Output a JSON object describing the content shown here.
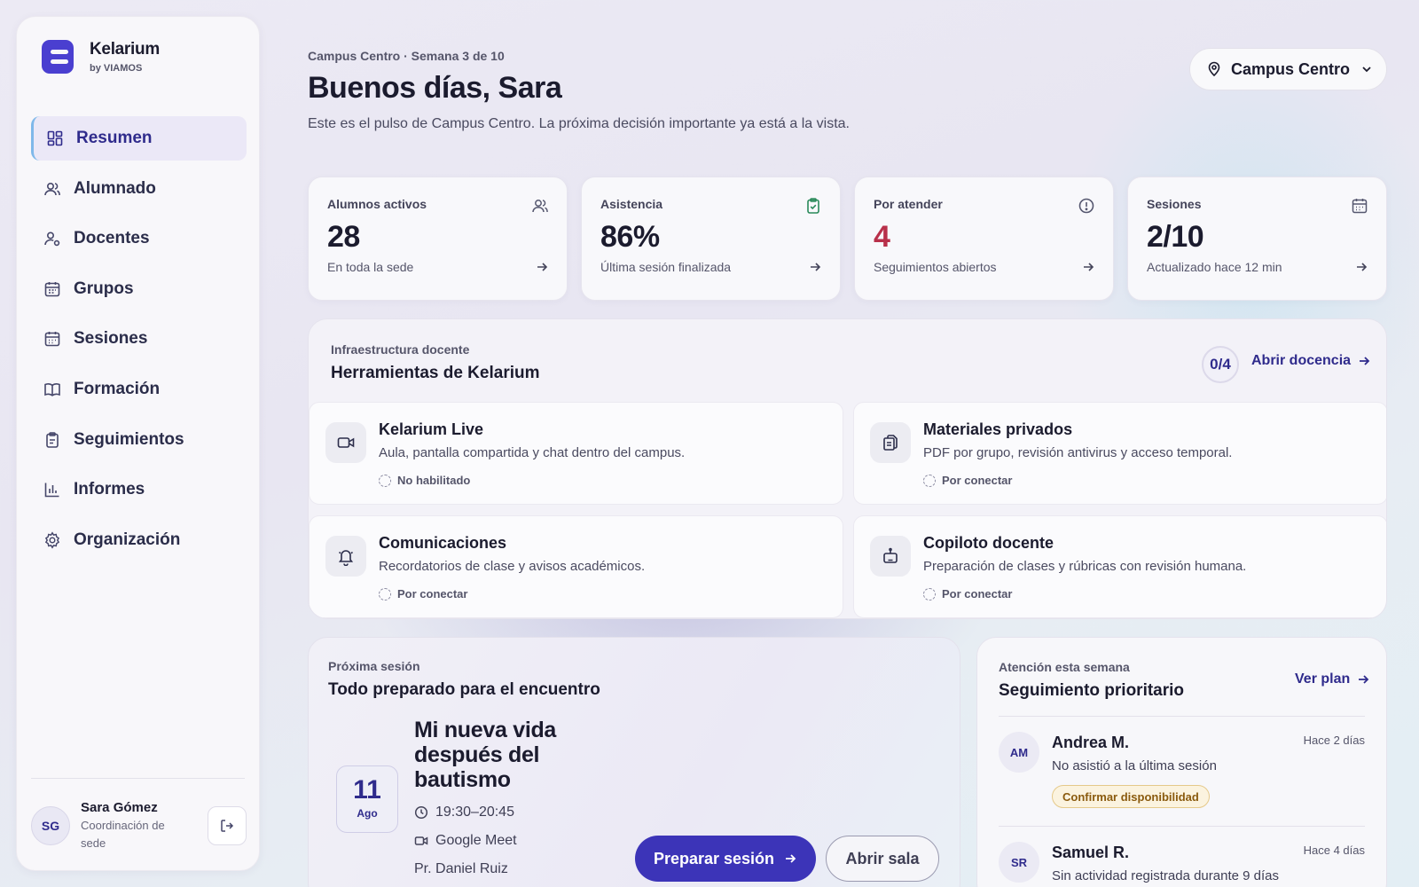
{
  "brand": {
    "name": "Kelarium",
    "sub": "by VIAMOS"
  },
  "sidebar": {
    "items": [
      {
        "label": "Resumen",
        "icon": "grid-icon",
        "active": true
      },
      {
        "label": "Alumnado",
        "icon": "users-icon"
      },
      {
        "label": "Docentes",
        "icon": "teacher-icon"
      },
      {
        "label": "Grupos",
        "icon": "calendar-grid-icon"
      },
      {
        "label": "Sesiones",
        "icon": "calendar-icon"
      },
      {
        "label": "Formación",
        "icon": "book-icon"
      },
      {
        "label": "Seguimientos",
        "icon": "clipboard-icon"
      },
      {
        "label": "Informes",
        "icon": "bar-chart-icon"
      },
      {
        "label": "Organización",
        "icon": "gear-icon"
      }
    ],
    "user": {
      "initials": "SG",
      "name": "Sara Gómez",
      "role": "Coordinación de sede"
    }
  },
  "header": {
    "eyebrow": "Campus Centro · Semana 3 de 10",
    "title": "Buenos días, Sara",
    "lead": "Este es el pulso de Campus Centro. La próxima decisión importante ya está a la vista.",
    "campus": "Campus Centro"
  },
  "stats": [
    {
      "label": "Alumnos activos",
      "value": "28",
      "sub": "En toda la sede",
      "icon": "users-icon"
    },
    {
      "label": "Asistencia",
      "value": "86%",
      "sub": "Última sesión finalizada",
      "icon": "clipboard-check-icon"
    },
    {
      "label": "Por atender",
      "value": "4",
      "sub": "Seguimientos abiertos",
      "icon": "alert-circle-icon"
    },
    {
      "label": "Sesiones",
      "value": "2/10",
      "sub": "Actualizado hace 12 min",
      "icon": "calendar-icon"
    }
  ],
  "tools": {
    "eyebrow": "Infraestructura docente",
    "title": "Herramientas de Kelarium",
    "count": "0/4",
    "link": "Abrir docencia",
    "items": [
      {
        "name": "Kelarium Live",
        "desc": "Aula, pantalla compartida y chat dentro del campus.",
        "status": "No habilitado",
        "icon": "video-icon"
      },
      {
        "name": "Materiales privados",
        "desc": "PDF por grupo, revisión antivirus y acceso temporal.",
        "status": "Por conectar",
        "icon": "files-icon"
      },
      {
        "name": "Comunicaciones",
        "desc": "Recordatorios de clase y avisos académicos.",
        "status": "Por conectar",
        "icon": "bell-icon"
      },
      {
        "name": "Copiloto docente",
        "desc": "Preparación de clases y rúbricas con revisión humana.",
        "status": "Por conectar",
        "icon": "robot-icon"
      }
    ]
  },
  "next_session": {
    "eyebrow": "Próxima sesión",
    "title": "Todo preparado para el encuentro",
    "day": "11",
    "month": "Ago",
    "session_title": "Mi nueva vida después del bautismo",
    "time": "19:30–20:45",
    "platform": "Google Meet",
    "teacher": "Pr. Daniel Ruiz",
    "primary_button": "Preparar sesión",
    "secondary_button": "Abrir sala"
  },
  "attention": {
    "eyebrow": "Atención esta semana",
    "title": "Seguimiento prioritario",
    "link": "Ver plan",
    "items": [
      {
        "initials": "AM",
        "name": "Andrea M.",
        "time": "Hace 2 días",
        "desc": "No asistió a la última sesión",
        "tag": "Confirmar disponibilidad"
      },
      {
        "initials": "SR",
        "name": "Samuel R.",
        "time": "Hace 4 días",
        "desc": "Sin actividad registrada durante 9 días"
      }
    ]
  },
  "colors": {
    "accent": "#3c34b8",
    "alert": "#b8304a",
    "tag": "#fbf3df"
  }
}
